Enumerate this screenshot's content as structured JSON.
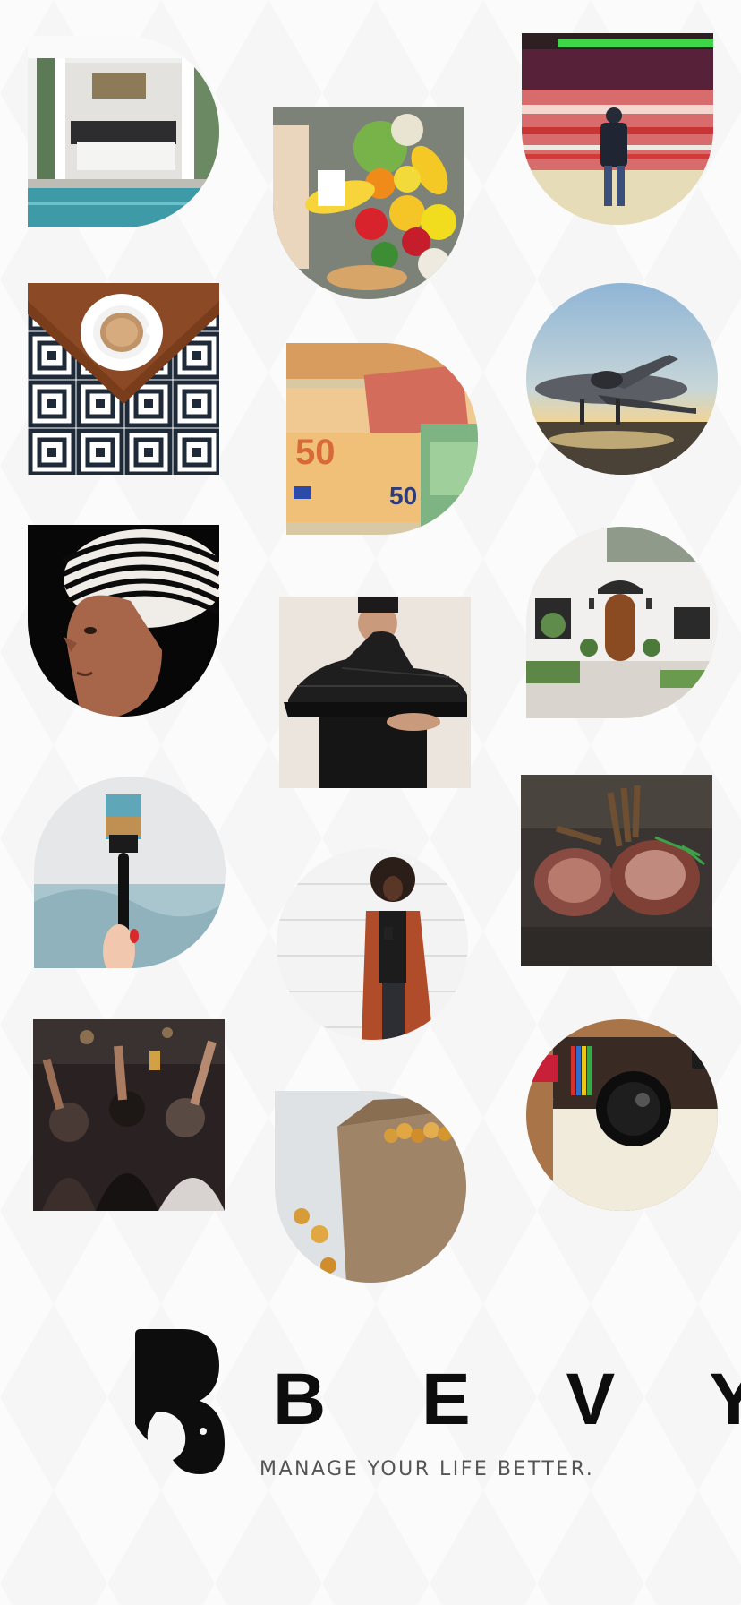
{
  "gallery": {
    "tiles": [
      {
        "icon": "bedroom-pool-photo",
        "shape": "d-right"
      },
      {
        "icon": "groceries-photo",
        "shape": "u-bottom"
      },
      {
        "icon": "train-station-photo",
        "shape": "u-bottom"
      },
      {
        "icon": "coffee-cup-photo",
        "shape": "square"
      },
      {
        "icon": "euro-banknotes-photo",
        "shape": "d-right"
      },
      {
        "icon": "private-jet-photo",
        "shape": "circle"
      },
      {
        "icon": "striped-headwrap-portrait-photo",
        "shape": "u-bottom"
      },
      {
        "icon": "sneaker-photo",
        "shape": "square"
      },
      {
        "icon": "house-facade-photo",
        "shape": "leaf-bl"
      },
      {
        "icon": "paint-brush-photo",
        "shape": "leaf-bl"
      },
      {
        "icon": "woman-phone-photo",
        "shape": "circle"
      },
      {
        "icon": "lamb-rack-dish-photo",
        "shape": "square"
      },
      {
        "icon": "concert-crowd-photo",
        "shape": "square"
      },
      {
        "icon": "popcorn-bag-photo",
        "shape": "leaf-tr"
      },
      {
        "icon": "instagram-camera-illustration-photo",
        "shape": "circle"
      }
    ]
  },
  "brand": {
    "logo_icon": "bevy-b-logo",
    "name": "B E V Y",
    "tagline": "MANAGE YOUR LIFE BETTER."
  },
  "colors": {
    "background": "#f6f6f7",
    "brand_text": "#0d0d0d",
    "tagline_text": "#555555"
  }
}
